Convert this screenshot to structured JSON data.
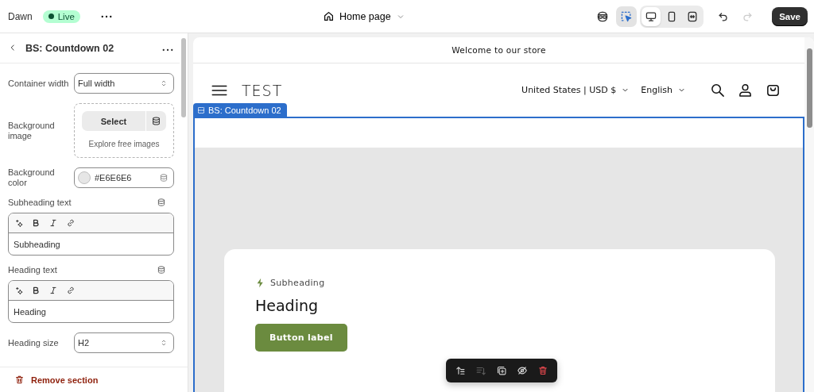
{
  "topbar": {
    "theme": "Dawn",
    "status": {
      "label": "Live",
      "live": true
    },
    "page": "Home page",
    "tools": [
      {
        "kind": "inspector",
        "selected": false
      },
      {
        "kind": "inspect",
        "selected": true
      }
    ],
    "devices": [
      {
        "kind": "desktop",
        "selected": true
      },
      {
        "kind": "mobile",
        "selected": false
      },
      {
        "kind": "fullwidth",
        "selected": false
      }
    ],
    "history": [
      {
        "kind": "undo",
        "disabled": false
      },
      {
        "kind": "redo",
        "disabled": true
      }
    ],
    "save": "Save"
  },
  "panel": {
    "title": "BS: Countdown 02",
    "fields": [
      {
        "kind": "select",
        "label": "Container width",
        "value": "Full width"
      },
      {
        "kind": "image",
        "label": "Background image",
        "button": "Select",
        "link": "Explore free images"
      },
      {
        "kind": "color",
        "label": "Background color",
        "value": "#E6E6E6"
      },
      {
        "kind": "richtext",
        "label": "Subheading text",
        "value": "Subheading"
      },
      {
        "kind": "richtext",
        "label": "Heading text",
        "value": "Heading"
      },
      {
        "kind": "select",
        "label": "Heading size",
        "value": "H2"
      }
    ],
    "remove": "Remove section"
  },
  "preview": {
    "announcement": "Welcome to our store",
    "logo": "TEST",
    "country": "United States | USD $",
    "language": "English",
    "section_tag": "BS: Countdown 02",
    "card": {
      "subheading": "Subheading",
      "heading": "Heading",
      "button": "Button label"
    },
    "actions": [
      {
        "kind": "move-up",
        "disabled": false
      },
      {
        "kind": "move-down",
        "disabled": true
      },
      {
        "kind": "duplicate",
        "disabled": false
      },
      {
        "kind": "hide",
        "disabled": false
      },
      {
        "kind": "delete",
        "disabled": false
      }
    ]
  }
}
